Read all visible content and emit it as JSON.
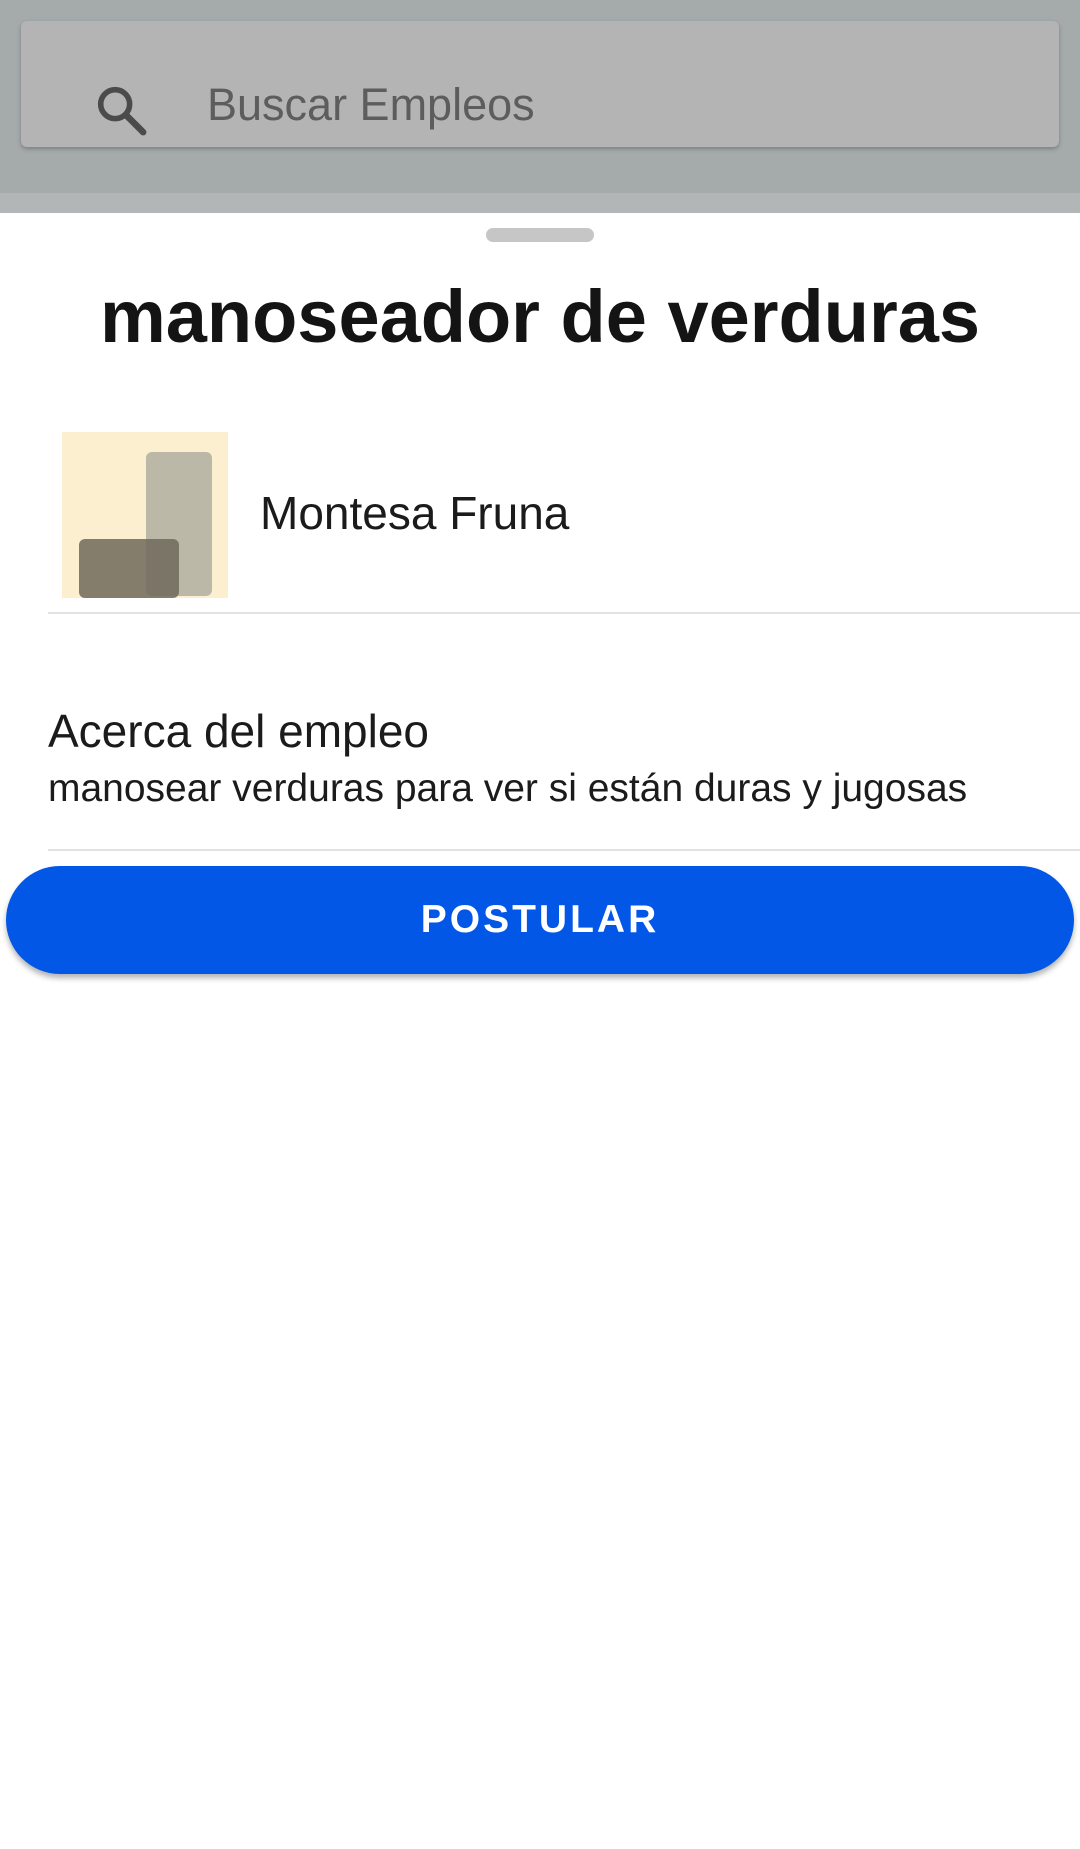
{
  "search": {
    "placeholder": "Buscar Empleos",
    "icon": "search-icon"
  },
  "job": {
    "title": "manoseador de verduras",
    "company": "Montesa Fruna",
    "about_heading": "Acerca del empleo",
    "about_text": "manosear verduras para ver si están duras y jugosas"
  },
  "actions": {
    "apply_label": "POSTULAR"
  },
  "colors": {
    "scrim": "#a5aaab",
    "search_bar": "#b4b4b4",
    "accent": "#0257e6",
    "logo_background": "#fbefcf"
  }
}
